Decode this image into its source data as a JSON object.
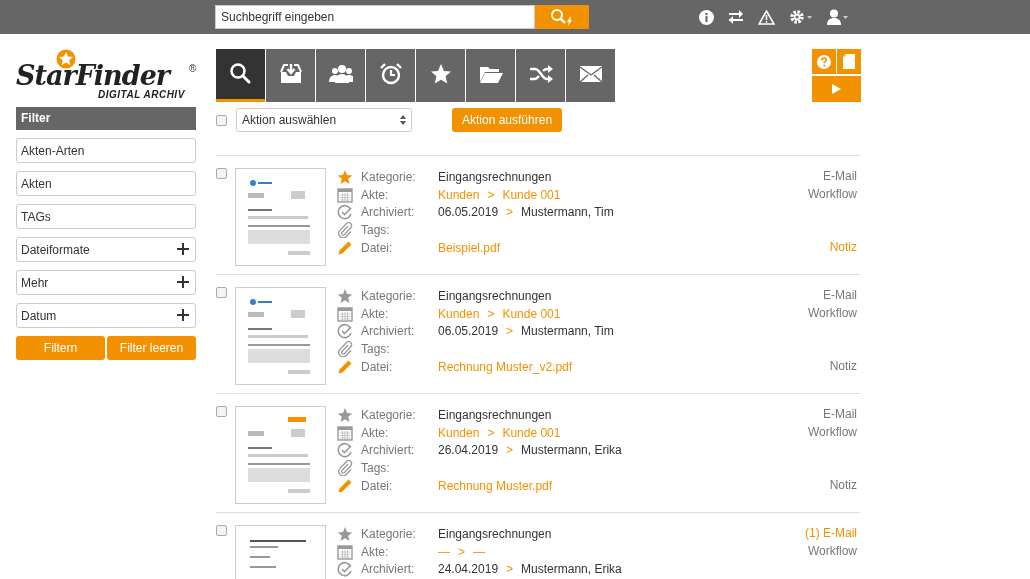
{
  "search": {
    "placeholder": "Suchbegriff eingeben"
  },
  "logo": {
    "name": "StarFinder",
    "mark": "®",
    "subtitle": "DIGITAL ARCHIV"
  },
  "tabs": [
    {
      "kind": "search",
      "selected": true
    },
    {
      "kind": "inbox",
      "selected": false
    },
    {
      "kind": "users",
      "selected": false
    },
    {
      "kind": "alarm",
      "selected": false
    },
    {
      "kind": "star",
      "selected": false
    },
    {
      "kind": "folder",
      "selected": false
    },
    {
      "kind": "shuffle",
      "selected": false
    },
    {
      "kind": "mail",
      "selected": false
    }
  ],
  "filter": {
    "title": "Filter",
    "fields": [
      {
        "placeholder": "Akten-Arten",
        "expandable": false
      },
      {
        "placeholder": "Akten",
        "expandable": false
      },
      {
        "placeholder": "TAGs",
        "expandable": false
      },
      {
        "placeholder": "Dateiformate",
        "expandable": true
      },
      {
        "placeholder": "Mehr",
        "expandable": true
      },
      {
        "placeholder": "Datum",
        "expandable": true
      }
    ],
    "buttons": [
      "Filtern",
      "Filter leeren"
    ]
  },
  "actions": {
    "all_checked": false,
    "select": "Aktion auswählen",
    "button": "Aktion ausführen"
  },
  "records": [
    {
      "checked": false,
      "starred": true,
      "fields": [
        {
          "kind": "category",
          "label": "Kategorie:",
          "value": "Eingangsrechnungen"
        },
        {
          "kind": "folder",
          "label": "Akte:",
          "path": [
            "Kunden",
            "Kunde 001"
          ],
          "separator": ">"
        },
        {
          "kind": "archived",
          "label": "Archiviert:",
          "date": "06.05.2019",
          "separator": ">",
          "user": "Mustermann, Tim"
        },
        {
          "kind": "tags",
          "label": "Tags:"
        },
        {
          "kind": "file",
          "label": "Datei:",
          "value": "Beispiel.pdf"
        }
      ],
      "email": {
        "label": "E-Mail",
        "highlighted": false
      },
      "workflow": {
        "label": "Workflow",
        "highlighted": false
      },
      "note": {
        "label": "Notiz",
        "highlighted": true
      }
    },
    {
      "checked": false,
      "starred": false,
      "fields": [
        {
          "kind": "category",
          "label": "Kategorie:",
          "value": "Eingangsrechnungen"
        },
        {
          "kind": "folder",
          "label": "Akte:",
          "path": [
            "Kunden",
            "Kunde 001"
          ],
          "separator": ">"
        },
        {
          "kind": "archived",
          "label": "Archiviert:",
          "date": "06.05.2019",
          "separator": ">",
          "user": "Mustermann, Tim"
        },
        {
          "kind": "tags",
          "label": "Tags:"
        },
        {
          "kind": "file",
          "label": "Datei:",
          "value": "Rechnung Muster_v2.pdf"
        }
      ],
      "email": {
        "label": "E-Mail",
        "highlighted": false
      },
      "workflow": {
        "label": "Workflow",
        "highlighted": false
      },
      "note": {
        "label": "Notiz",
        "highlighted": false
      }
    },
    {
      "checked": false,
      "starred": false,
      "fields": [
        {
          "kind": "category",
          "label": "Kategorie:",
          "value": "Eingangsrechnungen"
        },
        {
          "kind": "folder",
          "label": "Akte:",
          "path": [
            "Kunden",
            "Kunde 001"
          ],
          "separator": ">"
        },
        {
          "kind": "archived",
          "label": "Archiviert:",
          "date": "26.04.2019",
          "separator": ">",
          "user": "Mustermann, Erika"
        },
        {
          "kind": "tags",
          "label": "Tags:"
        },
        {
          "kind": "file",
          "label": "Datei:",
          "value": "Rechnung Muster.pdf"
        }
      ],
      "email": {
        "label": "E-Mail",
        "highlighted": false
      },
      "workflow": {
        "label": "Workflow",
        "highlighted": false
      },
      "note": {
        "label": "Notiz",
        "highlighted": false
      }
    },
    {
      "checked": false,
      "starred": false,
      "fields": [
        {
          "kind": "category",
          "label": "Kategorie:",
          "value": "Eingangsrechnungen"
        },
        {
          "kind": "folder",
          "label": "Akte:",
          "path": [
            "—",
            "—"
          ],
          "separator": ">"
        },
        {
          "kind": "archived",
          "label": "Archiviert:",
          "date": "24.04.2019",
          "separator": ">",
          "user": "Mustermann, Erika"
        }
      ],
      "email": {
        "label": "(1) E-Mail",
        "highlighted": true
      },
      "workflow": {
        "label": "Workflow",
        "highlighted": false
      }
    }
  ]
}
